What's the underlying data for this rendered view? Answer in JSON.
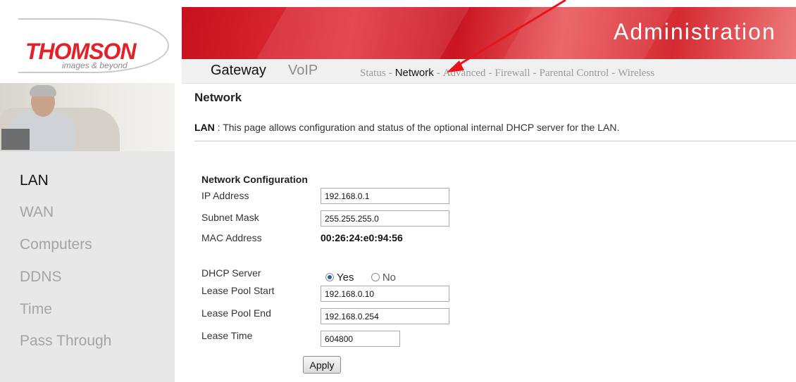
{
  "logo": {
    "brand": "THOMSON",
    "tagline": "images & beyond"
  },
  "header": {
    "title": "Administration"
  },
  "nav": {
    "main_tabs": [
      "Gateway",
      "VoIP"
    ],
    "sub_tabs": [
      "Status",
      "Network",
      "Advanced",
      "Firewall",
      "Parental Control",
      "Wireless"
    ],
    "sub_separator": "-",
    "active_sub": "Network"
  },
  "sidebar": {
    "items": [
      {
        "label": "LAN",
        "active": true
      },
      {
        "label": "WAN",
        "active": false
      },
      {
        "label": "Computers",
        "active": false
      },
      {
        "label": "DDNS",
        "active": false
      },
      {
        "label": "Time",
        "active": false
      },
      {
        "label": "Pass Through",
        "active": false
      }
    ]
  },
  "main": {
    "title": "Network",
    "desc_key": "LAN",
    "desc_text": ":  This page allows configuration and status of the optional internal DHCP server for the LAN.",
    "section_title": "Network Configuration",
    "ip_label": "IP Address",
    "ip_value": "192.168.0.1",
    "subnet_label": "Subnet Mask",
    "subnet_value": "255.255.255.0",
    "mac_label": "MAC Address",
    "mac_value": "00:26:24:e0:94:56",
    "dhcp_label": "DHCP Server",
    "dhcp_yes": "Yes",
    "dhcp_no": "No",
    "dhcp_selected": "Yes",
    "pool_start_label": "Lease Pool Start",
    "pool_start_value": "192.168.0.10",
    "pool_end_label": "Lease Pool End",
    "pool_end_value": "192.168.0.254",
    "lease_time_label": "Lease Time",
    "lease_time_value": "604800",
    "apply_label": "Apply"
  },
  "colors": {
    "accent_red": "#e2222a",
    "banner_red": "#c8101e",
    "arrow_red": "#e8141a"
  }
}
